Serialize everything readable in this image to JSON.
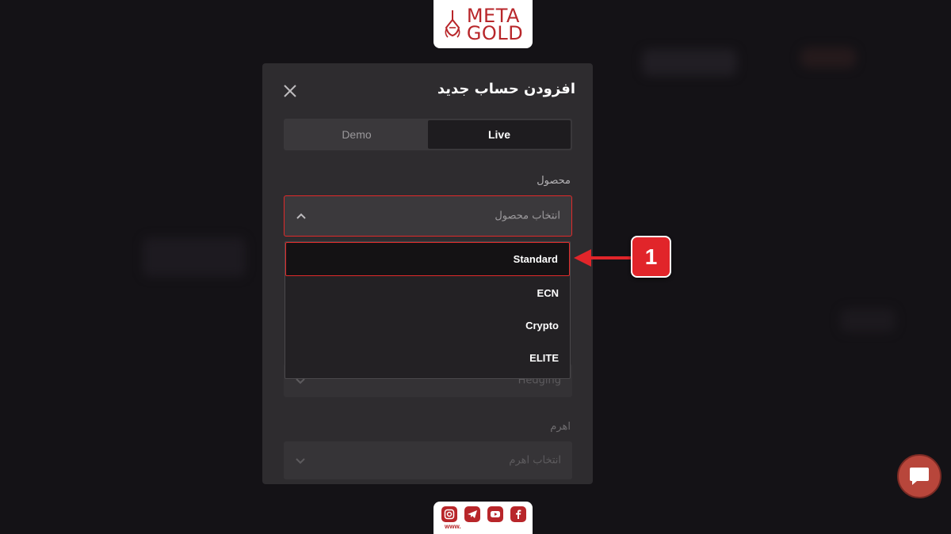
{
  "brand": {
    "line1": "META",
    "line2": "GOLD",
    "color": "#b8262a"
  },
  "modal": {
    "title": "افزودن حساب جدید",
    "tabs": {
      "demo": "Demo",
      "live": "Live",
      "selected": "Live"
    },
    "product_label": "محصول",
    "product_placeholder": "انتخاب محصول",
    "hidden_field_value": "Hedging",
    "leverage_label": "اهرم",
    "leverage_placeholder": "انتخاب اهرم"
  },
  "dropdown": {
    "options": [
      "Standard",
      "ECN",
      "Crypto",
      "ELITE"
    ],
    "highlighted": "Standard"
  },
  "annotation": {
    "step": "1",
    "color": "#e1252a"
  },
  "social": {
    "icons": [
      "instagram-icon",
      "telegram-icon",
      "youtube-icon",
      "facebook-icon"
    ],
    "www": "www."
  },
  "colors": {
    "accent": "#e02a2a",
    "modal_bg": "#2e2c2f",
    "page_bg": "#141216"
  }
}
